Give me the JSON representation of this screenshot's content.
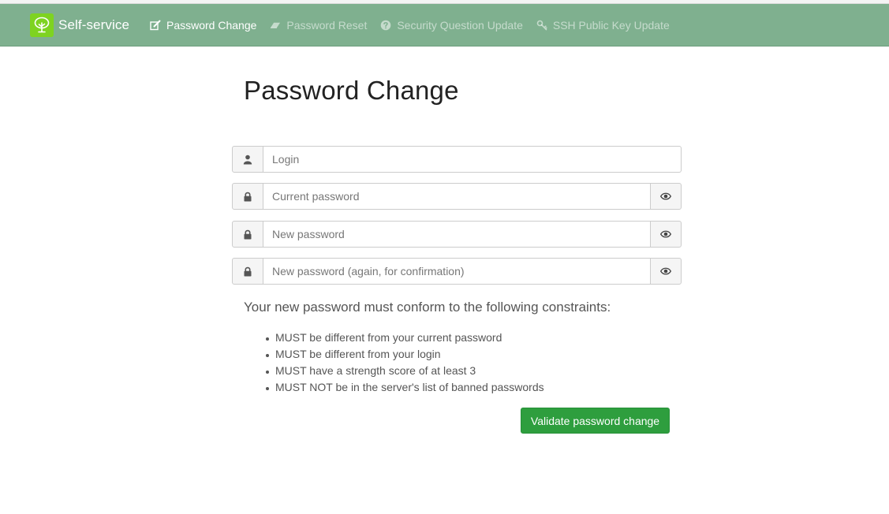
{
  "brand": {
    "name": "Self-service",
    "logo_icon": "tree-icon"
  },
  "nav": {
    "items": [
      {
        "label": "Password Change",
        "icon": "edit-icon",
        "active": true
      },
      {
        "label": "Password Reset",
        "icon": "eraser-icon",
        "active": false
      },
      {
        "label": "Security Question Update",
        "icon": "question-circle-icon",
        "active": false
      },
      {
        "label": "SSH Public Key Update",
        "icon": "key-icon",
        "active": false
      }
    ]
  },
  "page": {
    "title": "Password Change"
  },
  "form": {
    "login": {
      "placeholder": "Login",
      "value": "",
      "icon": "user-icon"
    },
    "current_password": {
      "placeholder": "Current password",
      "value": "",
      "icon": "lock-icon",
      "toggle_icon": "eye-icon"
    },
    "new_password": {
      "placeholder": "New password",
      "value": "",
      "icon": "lock-icon",
      "toggle_icon": "eye-icon"
    },
    "confirm_password": {
      "placeholder": "New password (again, for confirmation)",
      "value": "",
      "icon": "lock-icon",
      "toggle_icon": "eye-icon"
    },
    "submit_label": "Validate password change"
  },
  "constraints": {
    "title": "Your new password must conform to the following constraints:",
    "items": [
      "MUST be different from your current password",
      "MUST be different from your login",
      "MUST have a strength score of at least 3",
      "MUST NOT be in the server's list of banned passwords"
    ]
  },
  "colors": {
    "navbar": "#7fb08f",
    "brand_logo": "#7ed321",
    "submit_button": "#2e9e3e"
  }
}
